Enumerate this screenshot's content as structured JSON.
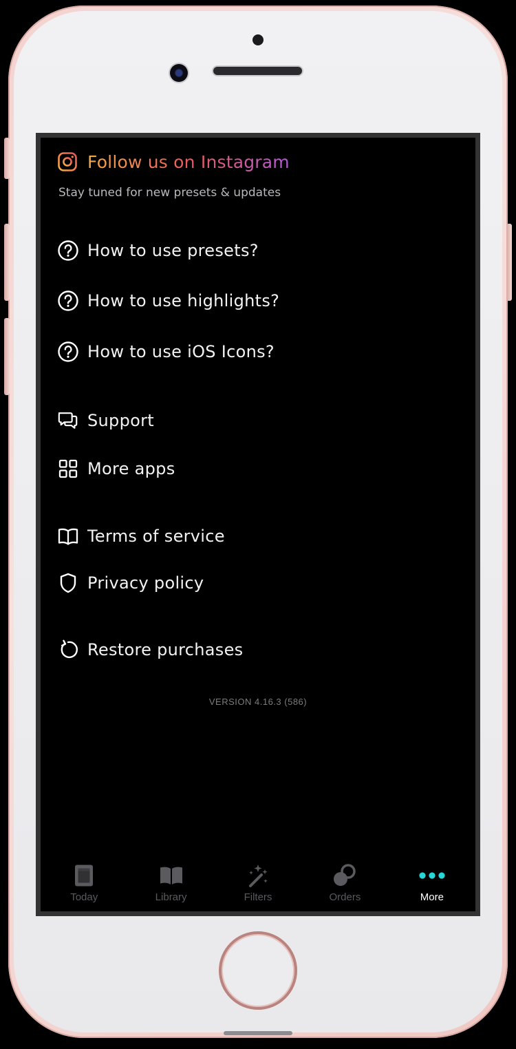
{
  "device": {
    "accent_color": "#ead0cc",
    "theme": "rose-gold iPhone"
  },
  "instagram": {
    "title": "Follow us on Instagram",
    "subtitle": "Stay tuned for new presets & updates",
    "icon": "instagram-icon"
  },
  "menu": {
    "items": [
      {
        "label": "How to use presets?",
        "icon": "question-circle-icon"
      },
      {
        "label": "How to use highlights?",
        "icon": "question-circle-icon"
      },
      {
        "label": "How to use iOS Icons?",
        "icon": "question-circle-icon"
      },
      {
        "label": "Support",
        "icon": "chat-bubbles-icon"
      },
      {
        "label": "More apps",
        "icon": "grid-icon"
      },
      {
        "label": "Terms of service",
        "icon": "book-icon"
      },
      {
        "label": "Privacy policy",
        "icon": "shield-icon"
      },
      {
        "label": "Restore purchases",
        "icon": "restore-icon"
      }
    ]
  },
  "version": "VERSION 4.16.3 (586)",
  "tabbar": {
    "active_color": "#27d6d6",
    "inactive_color": "#5a5a5f",
    "tabs": [
      {
        "label": "Today",
        "icon": "phone-page-icon",
        "active": false
      },
      {
        "label": "Library",
        "icon": "open-book-icon",
        "active": false
      },
      {
        "label": "Filters",
        "icon": "magic-wand-icon",
        "active": false
      },
      {
        "label": "Orders",
        "icon": "orders-icon",
        "active": false
      },
      {
        "label": "More",
        "icon": "more-dots-icon",
        "active": true
      }
    ]
  }
}
